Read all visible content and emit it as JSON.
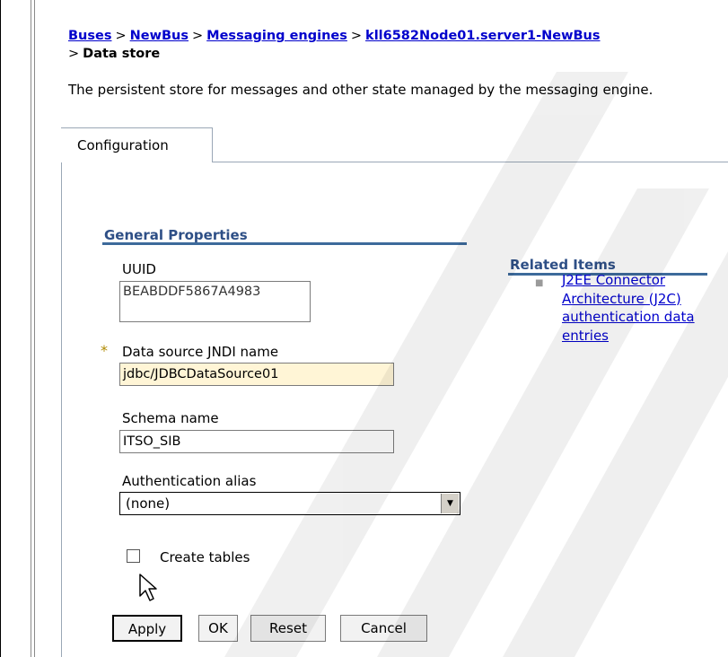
{
  "breadcrumb": {
    "links": [
      "Buses",
      "NewBus",
      "Messaging engines",
      "kll6582Node01.server1-NewBus"
    ],
    "separator": ">",
    "current": "Data store"
  },
  "description": "The persistent store for messages and other state managed by the messaging engine.",
  "tab": {
    "label": "Configuration"
  },
  "general_properties": {
    "title": "General Properties",
    "uuid": {
      "label": "UUID",
      "value": "BEABDDF5867A4983"
    },
    "data_source": {
      "label": "Data source JNDI name",
      "required_marker": "*",
      "value": "jdbc/JDBCDataSource01"
    },
    "schema": {
      "label": "Schema name",
      "value": "ITSO_SIB"
    },
    "auth_alias": {
      "label": "Authentication alias",
      "selected": "(none)"
    },
    "create_tables": {
      "label": "Create tables",
      "checked": false
    }
  },
  "related_items": {
    "title": "Related Items",
    "links": [
      "J2EE Connector Architecture (J2C) authentication data entries"
    ]
  },
  "buttons": {
    "apply": "Apply",
    "ok": "OK",
    "reset": "Reset",
    "cancel": "Cancel"
  },
  "icons": {
    "cursor": "mouse-pointer-icon",
    "dropdown": "chevron-down-icon",
    "bullet": "square-bullet-icon"
  }
}
